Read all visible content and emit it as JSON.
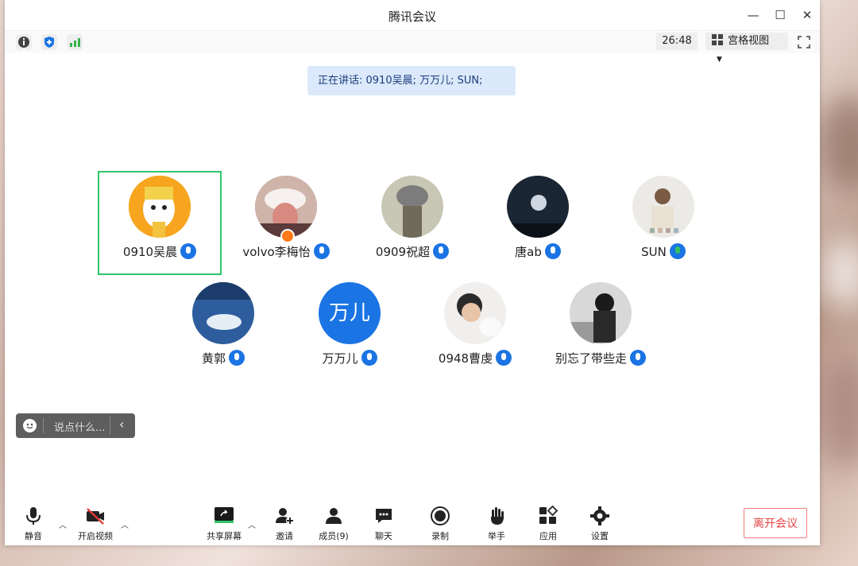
{
  "window": {
    "title": "腾讯会议"
  },
  "toolbar": {
    "timer": "26:48",
    "view_label": "宫格视图"
  },
  "speaking": {
    "text": "正在讲话: 0910吴晨; 万万儿; SUN;"
  },
  "participants": [
    {
      "name": "0910吴晨",
      "avatar": "cartoon",
      "mic": "blue",
      "active": true
    },
    {
      "name": "volvo李梅怡",
      "avatar": "photo",
      "mic": "blue",
      "host_badge": true
    },
    {
      "name": "0909祝超",
      "avatar": "photo",
      "mic": "blue"
    },
    {
      "name": "唐ab",
      "avatar": "photo",
      "mic": "blue"
    },
    {
      "name": "SUN",
      "avatar": "photo",
      "mic": "green"
    },
    {
      "name": "黄郭",
      "avatar": "photo",
      "mic": "blue"
    },
    {
      "name": "万万儿",
      "avatar": "text",
      "avatar_text": "万儿",
      "mic": "blue"
    },
    {
      "name": "0948曹虔",
      "avatar": "photo",
      "mic": "blue"
    },
    {
      "name": "别忘了带些走",
      "avatar": "photo",
      "mic": "blue"
    }
  ],
  "chat": {
    "placeholder": "说点什么..."
  },
  "bottom": {
    "mute": "静音",
    "video": "开启视频",
    "share": "共享屏幕",
    "invite": "邀请",
    "members": "成员(9)",
    "chat": "聊天",
    "record": "录制",
    "raise_hand": "举手",
    "apps": "应用",
    "settings": "设置",
    "leave": "离开会议"
  },
  "colors": {
    "accent": "#1b74e4",
    "active_border": "#2ec76b",
    "leave": "#e54545"
  }
}
